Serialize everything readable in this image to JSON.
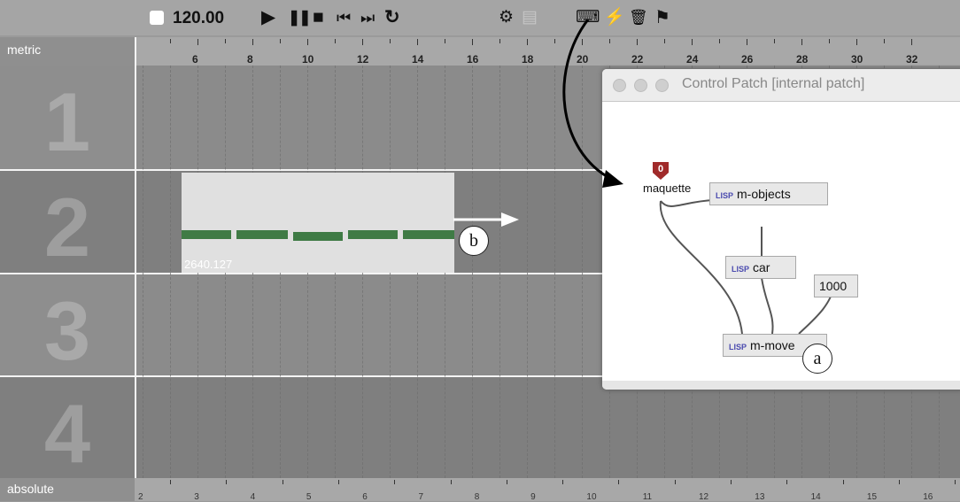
{
  "toolbar": {
    "tempo": "120.00",
    "play": "▶",
    "pause": "❚❚",
    "stop": "■",
    "prev": "⏮",
    "next": "⏭",
    "loop": "↻",
    "tool1": "⚙",
    "tool2": "▤",
    "tool3": "⌨",
    "tool4": "⚡",
    "tool5": "🗑",
    "tool6": "⚑"
  },
  "ruler_top": {
    "label": "metric",
    "ticks": [
      "6",
      "8",
      "10",
      "12",
      "14",
      "16",
      "18",
      "20",
      "22",
      "24",
      "26",
      "28",
      "30",
      "32"
    ]
  },
  "ruler_bottom": {
    "label": "absolute",
    "ticks": [
      "2",
      "3",
      "4",
      "5",
      "6",
      "7",
      "8",
      "9",
      "10",
      "11",
      "12",
      "13",
      "14",
      "15",
      "16"
    ]
  },
  "tracks": [
    "1",
    "2",
    "3",
    "4"
  ],
  "box": {
    "value": "2640.127"
  },
  "annotations": {
    "a": "a",
    "b": "b"
  },
  "patch_window": {
    "title": "Control Patch  [internal patch]",
    "inlet_label": "maquette",
    "inlet_number": "0",
    "objects": {
      "m_objects": "m-objects",
      "car": "car",
      "m_move": "m-move",
      "number": "1000"
    },
    "lisp_tag": "LISP"
  }
}
